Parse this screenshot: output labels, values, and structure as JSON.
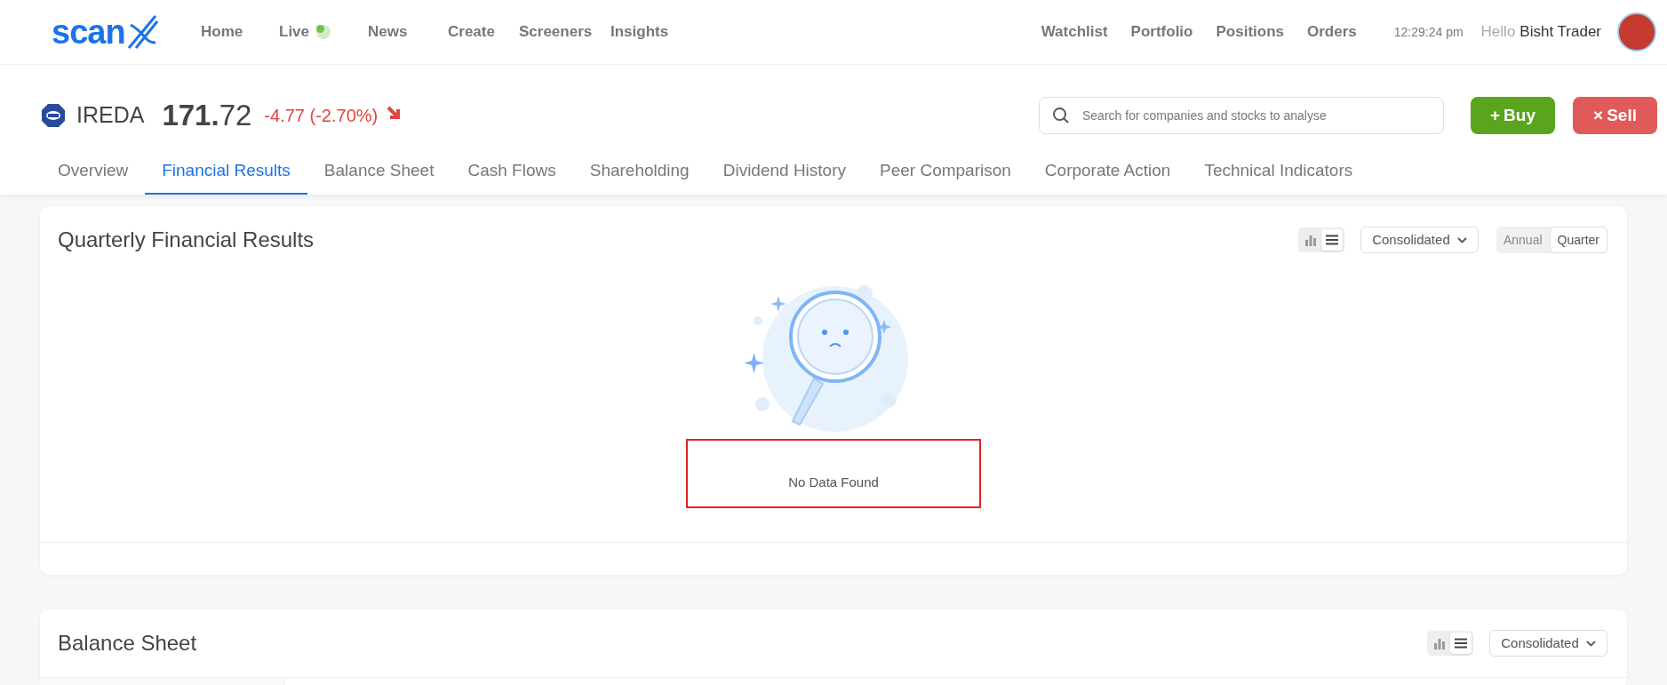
{
  "header": {
    "logo": "scan",
    "nav": [
      {
        "label": "Home",
        "live": false
      },
      {
        "label": "Live",
        "live": true
      },
      {
        "label": "News",
        "live": false
      },
      {
        "label": "Create",
        "live": false
      },
      {
        "label": "Screeners",
        "live": false
      },
      {
        "label": "Insights",
        "live": false
      }
    ],
    "right_nav": [
      "Watchlist",
      "Portfolio",
      "Positions",
      "Orders"
    ],
    "time": "12:29:24 pm",
    "greeting": "Hello",
    "user": "Bisht Trader"
  },
  "stock": {
    "symbol": "IREDA",
    "price_int": "171.",
    "price_dec": "72",
    "change": "-4.77 (-2.70%)",
    "falling": true
  },
  "search": {
    "placeholder": "Search for companies and stocks to analyse"
  },
  "actions": [
    {
      "kind": "buy",
      "icon": "+",
      "label": "Buy"
    },
    {
      "kind": "sell",
      "icon": "×",
      "label": "Sell"
    }
  ],
  "tabs": [
    {
      "label": "Overview",
      "selected": false
    },
    {
      "label": "Financial Results",
      "selected": true
    },
    {
      "label": "Balance Sheet",
      "selected": false
    },
    {
      "label": "Cash Flows",
      "selected": false
    },
    {
      "label": "Shareholding",
      "selected": false
    },
    {
      "label": "Dividend History",
      "selected": false
    },
    {
      "label": "Peer Comparison",
      "selected": false
    },
    {
      "label": "Corporate Action",
      "selected": false
    },
    {
      "label": "Technical Indicators",
      "selected": false
    }
  ],
  "sections": [
    {
      "title": "Quarterly Financial Results",
      "table_view": true,
      "dropdown": "Consolidated",
      "periods": [
        {
          "label": "Annual",
          "selected": false
        },
        {
          "label": "Quarter",
          "selected": true
        }
      ],
      "empty": {
        "message": "No Data Found",
        "highlighted": true
      }
    },
    {
      "title": "Balance Sheet",
      "table_view": true,
      "dropdown": "Consolidated"
    }
  ]
}
